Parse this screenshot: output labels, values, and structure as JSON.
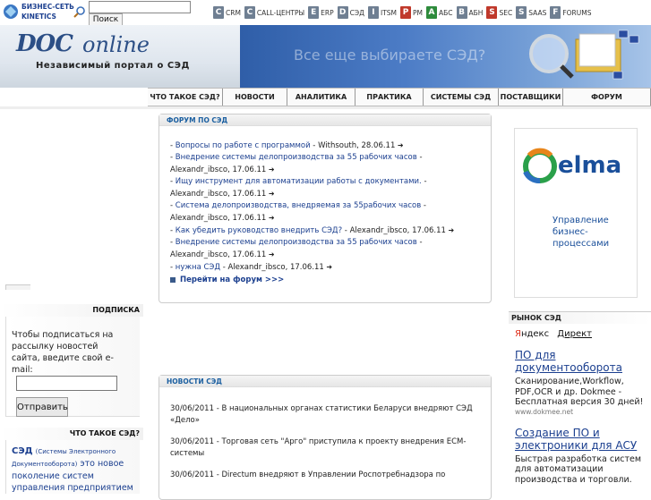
{
  "topbar": {
    "brand_line1": "БИЗНЕС-СЕТЬ",
    "brand_line2": "KINETICS",
    "search_placeholder": "",
    "search_button": "Поиск",
    "links": [
      {
        "letter": "C",
        "label": "CRM",
        "color": "#6f7f92"
      },
      {
        "letter": "C",
        "label": "CALL-ЦЕНТРЫ",
        "color": "#6f7f92"
      },
      {
        "letter": "E",
        "label": "ERP",
        "color": "#6f7f92"
      },
      {
        "letter": "D",
        "label": "СЭД",
        "color": "#6f7f92"
      },
      {
        "letter": "I",
        "label": "ITSM",
        "color": "#6f7f92"
      },
      {
        "letter": "P",
        "label": "PM",
        "color": "#c0392b"
      },
      {
        "letter": "A",
        "label": "АБС",
        "color": "#2e8b3c"
      },
      {
        "letter": "B",
        "label": "АБН",
        "color": "#6f7f92"
      },
      {
        "letter": "S",
        "label": "SEC",
        "color": "#c0392b"
      },
      {
        "letter": "S",
        "label": "SAAS",
        "color": "#6f7f92"
      },
      {
        "letter": "F",
        "label": "FORUMS",
        "color": "#6f7f92"
      }
    ]
  },
  "banner": {
    "logo_doc": "DOC",
    "logo_online": "online",
    "tagline": "Независимый портал о СЭД",
    "question": "Все еще выбираете СЭД?"
  },
  "nav": {
    "items": [
      "ЧТО ТАКОЕ СЭД?",
      "НОВОСТИ",
      "АНАЛИТИКА",
      "ПРАКТИКА",
      "СИСТЕМЫ СЭД",
      "ПОСТАВЩИКИ",
      "ФОРУМ"
    ]
  },
  "left": {
    "subscribe_header": "ПОДПИСКА",
    "subscribe_text": "Чтобы подписаться на рассылку новостей сайта, введите свой e-mail:",
    "subscribe_button": "Отправить",
    "what_header": "ЧТО ТАКОЕ СЭД?",
    "what_term": "СЭД",
    "what_abbr": "(Системы Электронного Документооборота)",
    "what_text": "это новое поколение систем управления предприятием"
  },
  "forum": {
    "header": "ФОРУМ ПО СЭД",
    "rows": [
      {
        "topic": "Вопросы по работе с программой",
        "meta": "Withsouth, 28.06.11"
      },
      {
        "topic": "Внедрение системы делопроизводства за 55 рабочих часов",
        "meta": "Alexandr_ibsco, 17.06.11"
      },
      {
        "topic": "Ищу инструмент для автоматизации работы с документами.",
        "meta": "Alexandr_ibsco, 17.06.11"
      },
      {
        "topic": "Система делопроизводства, внедряемая за     55рабочих часов",
        "meta": "Alexandr_ibsco, 17.06.11"
      },
      {
        "topic": "Как убедить руководство внедрить СЭД?",
        "meta": "Alexandr_ibsco, 17.06.11"
      },
      {
        "topic": "Внедрение системы делопроизводства за 55 рабочих часов",
        "meta": "Alexandr_ibsco, 17.06.11"
      },
      {
        "topic": "нужна СЭД",
        "meta": "Alexandr_ibsco, 17.06.11"
      }
    ],
    "more": "Перейти на форум >>>"
  },
  "news": {
    "header": "НОВОСТИ СЭД",
    "rows": [
      {
        "date": "30/06/2011",
        "text": "В национальных органах статистики Беларуси внедряют СЭД «Дело»"
      },
      {
        "date": "30/06/2011",
        "text": "Торговая сеть \"Арго\" приступила к проекту внедрения  ECM-системы"
      },
      {
        "date": "30/06/2011",
        "text": "Directum внедряют в Управлении Роспотребнадзора по"
      }
    ]
  },
  "right": {
    "elma_brand": "elma",
    "elma_line1": "Управление",
    "elma_line2": "бизнес-",
    "elma_line3": "процессами",
    "market_header": "РЫНОК СЭД",
    "yandex_y": "Я",
    "yandex_rest": "ндекс",
    "direct": "Директ",
    "ads": [
      {
        "title": "ПО для документооборота",
        "text": "Сканирование,Workflow, PDF,OCR и др. Dokmee - Бесплатная версия 30 дней!",
        "url": "www.dokmee.net"
      },
      {
        "title": "Создание ПО и электроники для АСУ",
        "text": "Быстрая разработка систем для автоматизации производства и торговли.",
        "url": ""
      }
    ]
  }
}
